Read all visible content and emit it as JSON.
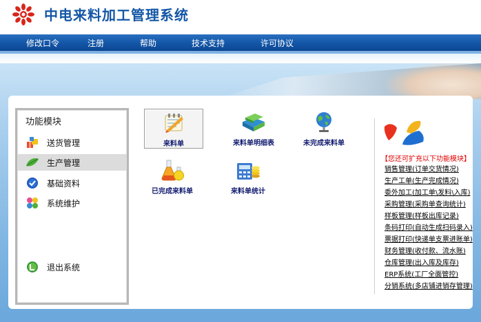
{
  "header": {
    "app_title": "中电来料加工管理系统"
  },
  "nav": {
    "items": [
      {
        "label": "修改口令"
      },
      {
        "label": "注册"
      },
      {
        "label": "帮助"
      },
      {
        "label": "技术支持"
      },
      {
        "label": "许可协议"
      }
    ]
  },
  "sidebar": {
    "title": "功能模块",
    "items": [
      {
        "label": "送货管理",
        "icon": "gift-box-icon"
      },
      {
        "label": "生产管理",
        "icon": "leaf-icon",
        "active": true
      },
      {
        "label": "基础资料",
        "icon": "check-circle-icon"
      },
      {
        "label": "系统维护",
        "icon": "puzzle-icon"
      }
    ],
    "exit_label": "退出系统",
    "exit_icon": "exit-icon"
  },
  "modules": [
    {
      "label": "来料单",
      "icon": "notepad-pencil-icon",
      "selected": true
    },
    {
      "label": "来料单明细表",
      "icon": "books-icon"
    },
    {
      "label": "未完成来料单",
      "icon": "globe-icon"
    },
    {
      "label": "已完成来料单",
      "icon": "flask-icon"
    },
    {
      "label": "来料单统计",
      "icon": "calculator-coins-icon"
    }
  ],
  "promo": {
    "title": "【您还可扩充以下功能模块】",
    "features": [
      "销售管理(订单交货情况)",
      "生产工单(生产完成情况)",
      "委外加工(加工单\\发料\\入库)",
      "采购管理(采购单查询统计)",
      "样板管理(样板出库记录)",
      "条码打印(自动生成扫码录入)",
      "票据打印(快递单支票进账单)",
      "财务管理(收付款、流水账)",
      "仓库管理(出入库及库存)",
      "ERP系统(工厂全面管控)",
      "分销系统(多店铺进销存管理)"
    ]
  },
  "colors": {
    "title_blue": "#1357a6",
    "nav_blue": "#1457a8",
    "module_label": "#101a6e",
    "promo_red": "#e00000"
  }
}
